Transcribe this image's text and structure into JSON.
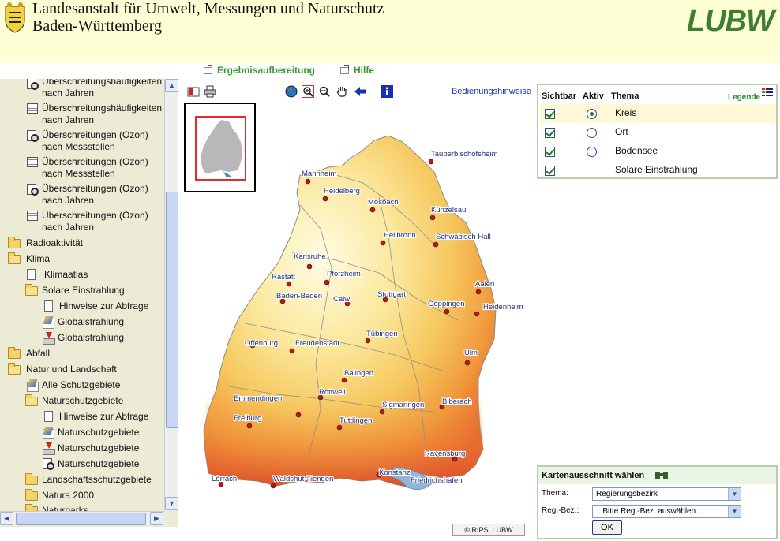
{
  "header": {
    "title_line1": "Landesanstalt für Umwelt, Messungen und Naturschutz",
    "title_line2": "Baden-Württemberg",
    "logo_text": "LUBW",
    "crest_icon": "coat-of-arms-icon"
  },
  "top_links": [
    {
      "label": "Ergebnisaufbereitung",
      "icon": "external-window-icon"
    },
    {
      "label": "Hilfe",
      "icon": "external-window-icon"
    }
  ],
  "tree": {
    "items": [
      {
        "label": "Überschreitungshäufigkeiten",
        "label2": "nach Jahren",
        "icon": "magnifier-document-icon"
      },
      {
        "label": "Überschreitungshäufigkeiten",
        "label2": "nach Jahren",
        "icon": "table-icon"
      },
      {
        "label": "Überschreitungen (Ozon)",
        "label2": "nach Messstellen",
        "icon": "magnifier-document-icon"
      },
      {
        "label": "Überschreitungen (Ozon)",
        "label2": "nach Messstellen",
        "icon": "table-icon"
      },
      {
        "label": "Überschreitungen (Ozon)",
        "label2": "nach Jahren",
        "icon": "magnifier-document-icon"
      },
      {
        "label": "Überschreitungen (Ozon)",
        "label2": "nach Jahren",
        "icon": "table-icon"
      },
      {
        "label": "Radioaktivität",
        "icon": "folder-icon"
      },
      {
        "label": "Klima",
        "icon": "folder-open-icon"
      },
      {
        "label": "Klimaatlas",
        "icon": "document-icon"
      },
      {
        "label": "Solare Einstrahlung",
        "icon": "folder-open-icon"
      },
      {
        "label": "Hinweise zur Abfrage",
        "icon": "document-icon"
      },
      {
        "label": "Globalstrahlung",
        "icon": "map-layer-icon"
      },
      {
        "label": "Globalstrahlung",
        "icon": "download-icon"
      },
      {
        "label": "Abfall",
        "icon": "folder-icon"
      },
      {
        "label": "Natur und Landschaft",
        "icon": "folder-open-icon"
      },
      {
        "label": "Alle Schutzgebiete",
        "icon": "map-layer-icon"
      },
      {
        "label": "Naturschutzgebiete",
        "icon": "folder-open-icon"
      },
      {
        "label": "Hinweise zur Abfrage",
        "icon": "document-icon"
      },
      {
        "label": "Naturschutzgebiete",
        "icon": "map-layer-icon"
      },
      {
        "label": "Naturschutzgebiete",
        "icon": "download-icon"
      },
      {
        "label": "Naturschutzgebiete",
        "icon": "magnifier-document-icon"
      },
      {
        "label": "Landschaftsschutzgebiete",
        "icon": "folder-icon"
      },
      {
        "label": "Natura 2000",
        "icon": "folder-icon"
      },
      {
        "label": "Naturparks",
        "icon": "folder-icon"
      }
    ]
  },
  "toolbar": {
    "tools": [
      "legend-toggle-icon",
      "print-icon",
      "globe-icon",
      "zoom-in-icon",
      "zoom-out-icon",
      "pan-hand-icon",
      "back-arrow-icon",
      "info-icon"
    ],
    "help_link": "Bedienungshinweise"
  },
  "map": {
    "cities": [
      "Tauberbischofsheim",
      "Mannheim",
      "Heidelberg",
      "Mosbach",
      "Künzelsau",
      "Heilbronn",
      "Schwäbisch Hall",
      "Karlsruhe",
      "Rastatt",
      "Pforzheim",
      "Baden-Baden",
      "Calw",
      "Stuttgart",
      "Aalen",
      "Göppingen",
      "Heidenheim",
      "Offenburg",
      "Freudenstadt",
      "Tübingen",
      "Ulm",
      "Balingen",
      "Emmendingen",
      "Rottweil",
      "Sigmaringen",
      "Biberach",
      "Freiburg",
      "Tuttlingen",
      "Ravensburg",
      "Lörrach",
      "Waldshut-Tiengen",
      "Konstanz",
      "Friedrichshafen"
    ],
    "copyright": "© RIPS, LUBW"
  },
  "layers_panel": {
    "col_visible": "Sichtbar",
    "col_active": "Aktiv",
    "col_theme": "Thema",
    "legend_label": "Legende",
    "rows": [
      {
        "name": "Kreis",
        "visible": true,
        "active": true,
        "has_radio": true
      },
      {
        "name": "Ort",
        "visible": true,
        "active": false,
        "has_radio": true
      },
      {
        "name": "Bodensee",
        "visible": true,
        "active": false,
        "has_radio": true
      },
      {
        "name": "Solare Einstrahlung",
        "visible": true,
        "active": false,
        "has_radio": false
      }
    ]
  },
  "extent_panel": {
    "title": "Kartenausschnitt wählen",
    "theme_label": "Thema:",
    "theme_value": "Regierungsbezirk",
    "region_label": "Reg.-Bez.:",
    "region_value": "...Bitte Reg.-Bez. auswählen...",
    "ok_label": "OK"
  },
  "colors": {
    "header_bg": "#ffffd6",
    "sidebar_bg": "#ebebd6",
    "link_green": "#3a9a2e",
    "logo_green": "#3e7d33"
  }
}
